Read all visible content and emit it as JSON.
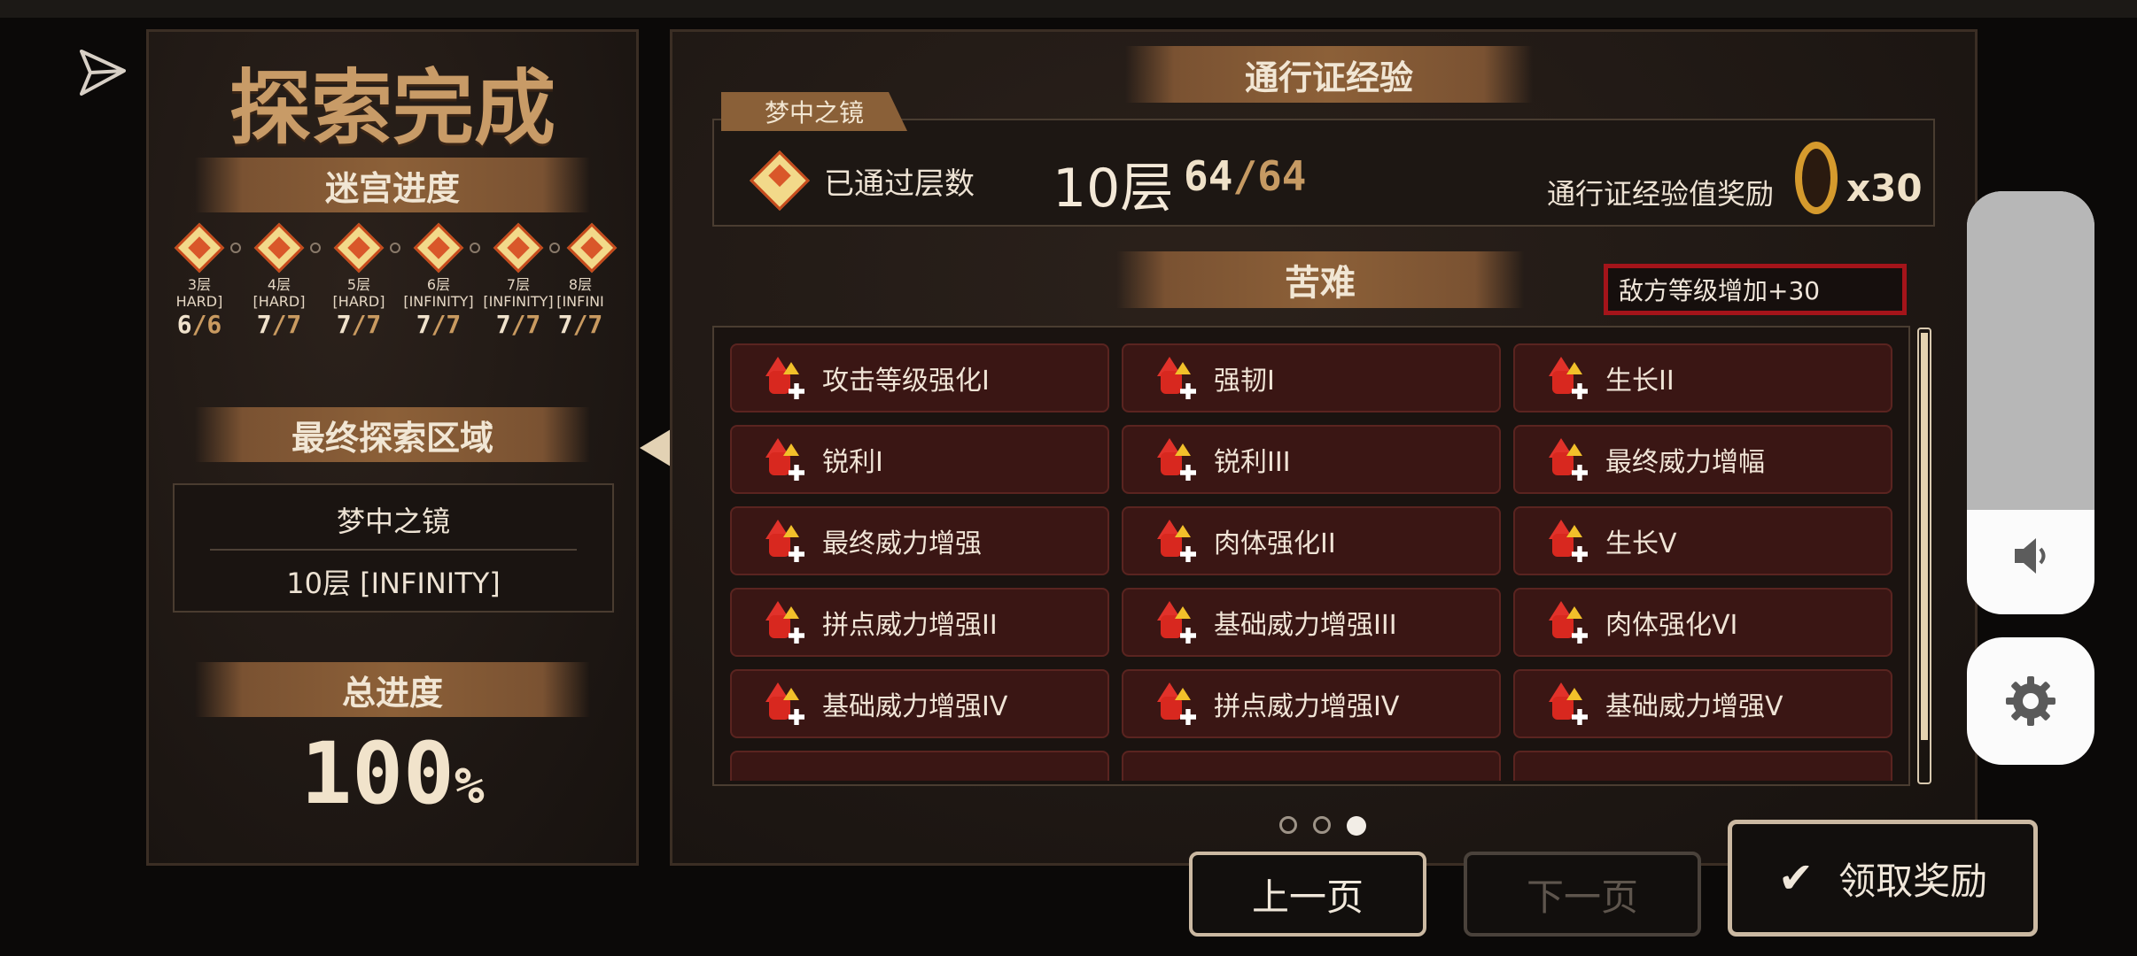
{
  "left_panel": {
    "title": "探索完成",
    "maze_progress_header": "迷宫进度",
    "floors": [
      {
        "name": "3层",
        "difficulty": "HARD]",
        "count": "6",
        "total": "/6"
      },
      {
        "name": "4层",
        "difficulty": "[HARD]",
        "count": "7",
        "total": "/7"
      },
      {
        "name": "5层",
        "difficulty": "[HARD]",
        "count": "7",
        "total": "/7"
      },
      {
        "name": "6层",
        "difficulty": "[INFINITY]",
        "count": "7",
        "total": "/7"
      },
      {
        "name": "7层",
        "difficulty": "[INFINITY]",
        "count": "7",
        "total": "/7"
      },
      {
        "name": "8层",
        "difficulty": "[INFINI",
        "count": "7",
        "total": "/7"
      }
    ],
    "final_area_header": "最终探索区域",
    "final_area_name": "梦中之镜",
    "final_area_floor": "10层 [INFINITY]",
    "total_progress_header": "总进度",
    "total_progress_value": "100",
    "total_progress_unit": "%"
  },
  "right_panel": {
    "pass_exp_header": "通行证经验",
    "mirror_tab": "梦中之镜",
    "floors_passed_label": "已通过层数",
    "floors_passed_value": "10层",
    "floors_passed_count": "64",
    "floors_passed_total": "/64",
    "pass_exp_reward_label": "通行证经验值奖励",
    "pass_exp_reward_multiplier": "x30",
    "hardship_header": "苦难",
    "enemy_level_note": "敌方等级增加+30",
    "hardships": [
      "攻击等级强化I",
      "强韧I",
      "生长II",
      "锐利I",
      "锐利III",
      "最终威力增幅",
      "最终威力增强",
      "肉体强化II",
      "生长V",
      "拼点威力增强II",
      "基础威力增强III",
      "肉体强化VI",
      "基础威力增强IV",
      "拼点威力增强IV",
      "基础威力增强V"
    ],
    "page_dots": [
      "inactive",
      "inactive",
      "active"
    ]
  },
  "buttons": {
    "prev_page": "上一页",
    "next_page": "下一页",
    "claim_reward": "领取奖励"
  },
  "colors": {
    "accent_gold": "#c89b67",
    "tile_red": "#3a1614",
    "highlight_border": "#a4141a"
  }
}
